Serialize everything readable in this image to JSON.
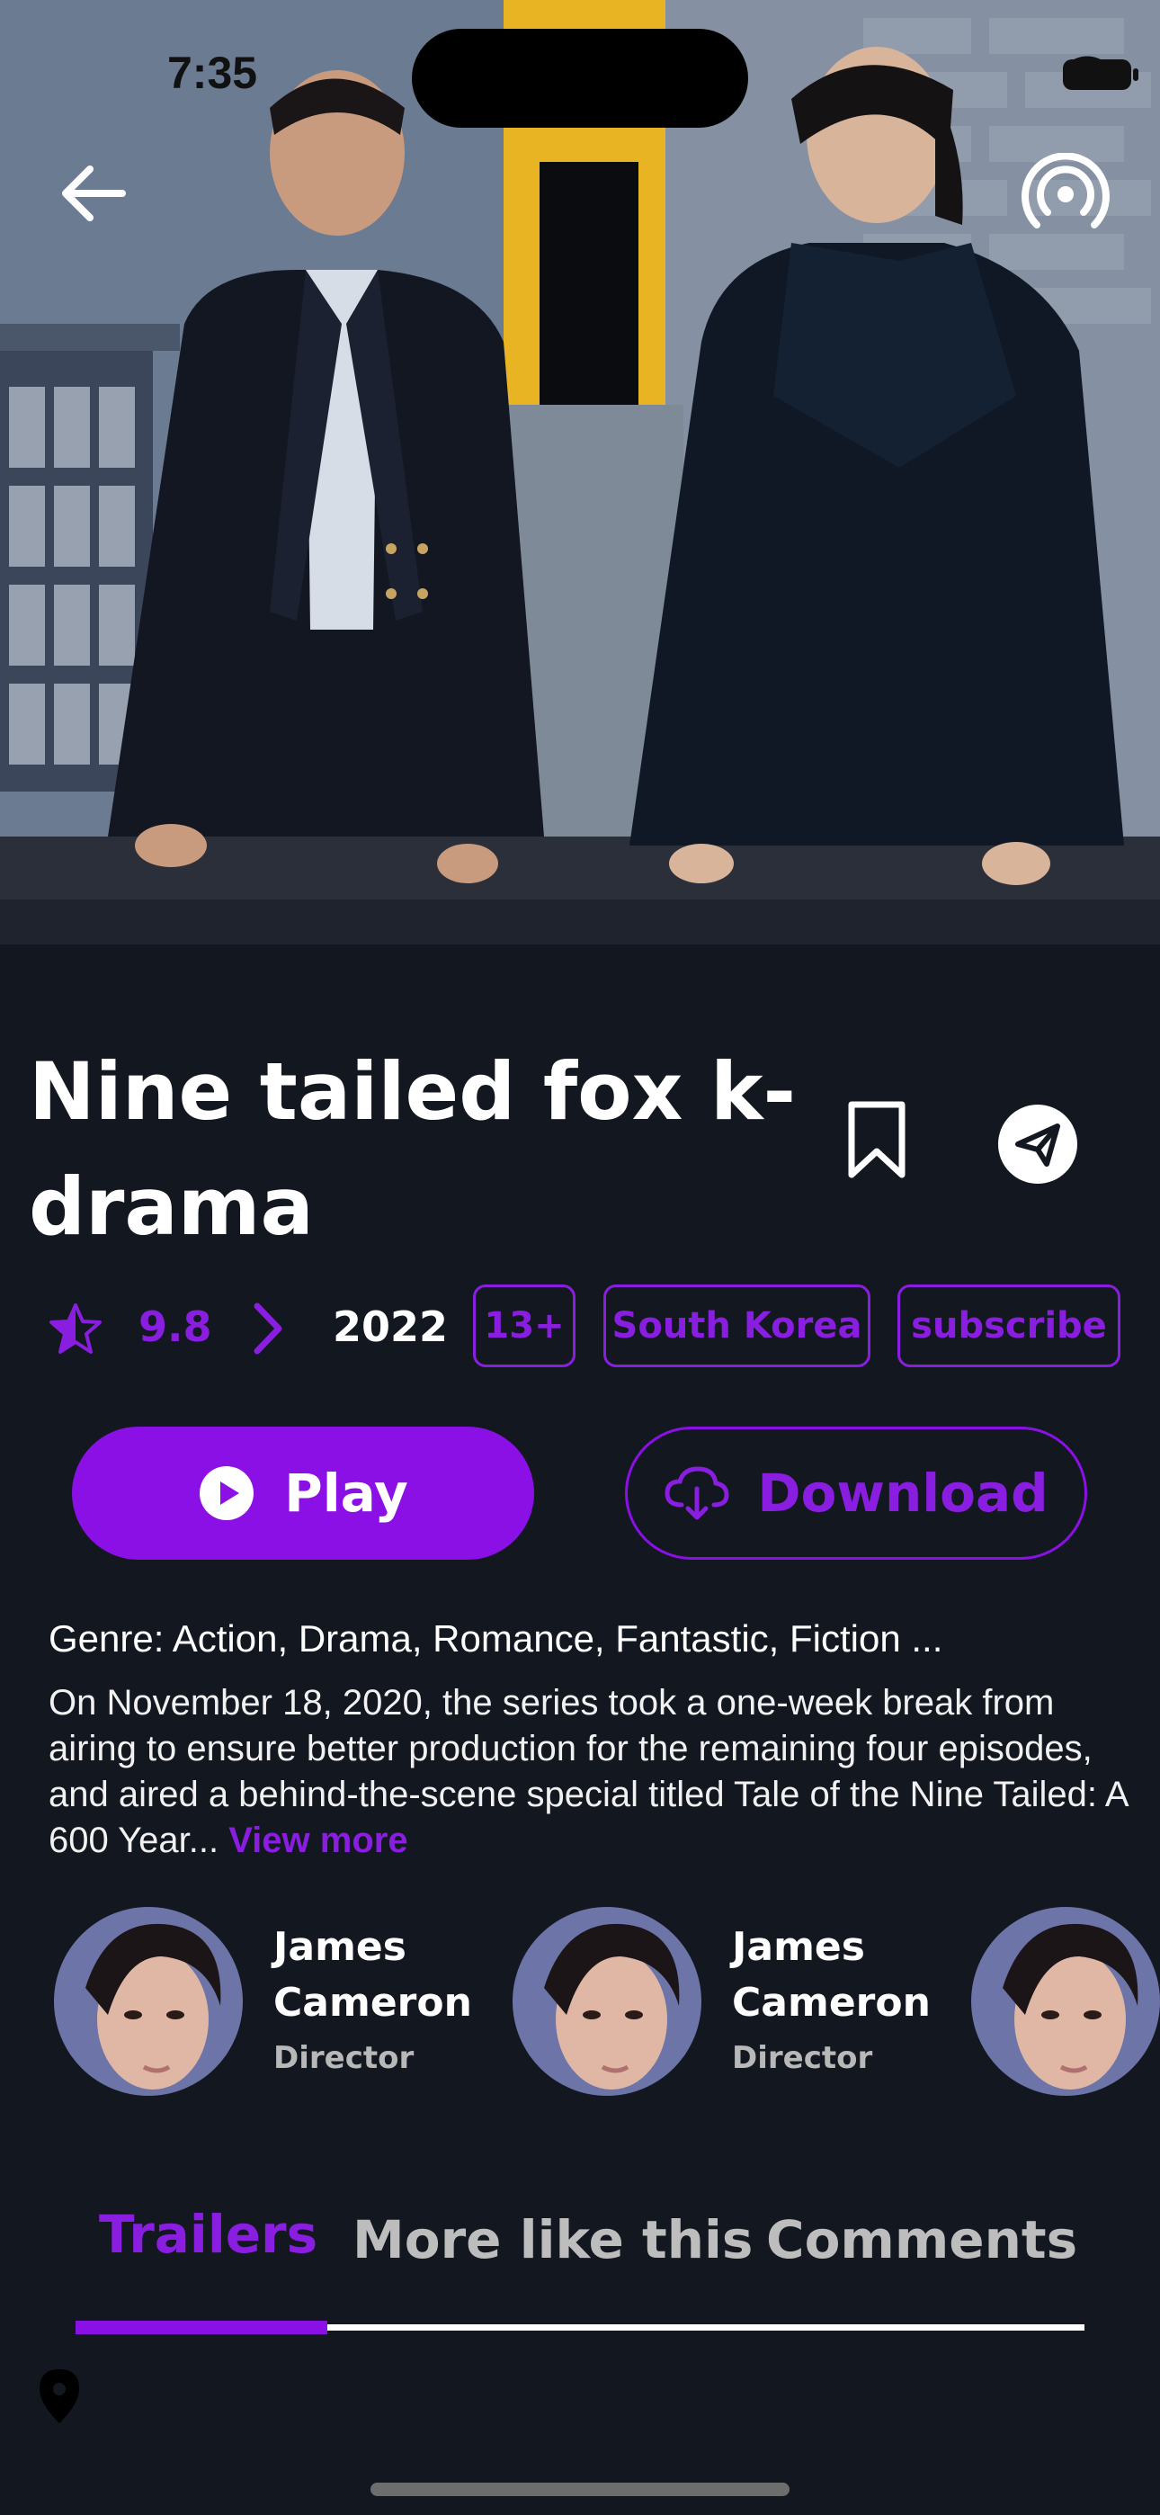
{
  "status_bar": {
    "time": "7:35"
  },
  "hero": {
    "image": "two men in long black coats walking on a street"
  },
  "movie": {
    "title": "Nine tailed fox k-drama",
    "rating": "9.8",
    "year": "2022",
    "age_rating": "13+",
    "country": "South Korea",
    "subscription": "subscribe"
  },
  "actions": {
    "play_label": "Play",
    "download_label": "Download"
  },
  "details": {
    "genre": "Genre: Action, Drama, Romance, Fantastic, Fiction ...",
    "description": "On November 18, 2020, the series took a one-week break from airing to ensure better production for the remaining four episodes, and aired a behind-the-scene special titled Tale of the Nine Tailed: A 600 Year... ",
    "view_more": "View more"
  },
  "cast": [
    {
      "name": "James Cameron",
      "role": "Director"
    },
    {
      "name": "James Cameron",
      "role": "Director"
    },
    {
      "name": "",
      "role": ""
    }
  ],
  "tabs": [
    {
      "label": "Trailers",
      "active": true
    },
    {
      "label": "More like this",
      "active": false
    },
    {
      "label": "Comments",
      "active": false
    }
  ],
  "icons": {
    "back": "arrow-left-icon",
    "cast": "broadcast-icon",
    "bookmark": "bookmark-icon",
    "send": "send-icon",
    "rating": "star-icon",
    "play": "play-circle-icon",
    "download": "cloud-download-icon",
    "location": "location-pin-icon"
  },
  "colors": {
    "accent": "#8a10e6",
    "background": "#131720",
    "text": "#ffffff",
    "muted": "#bdbdbd"
  }
}
